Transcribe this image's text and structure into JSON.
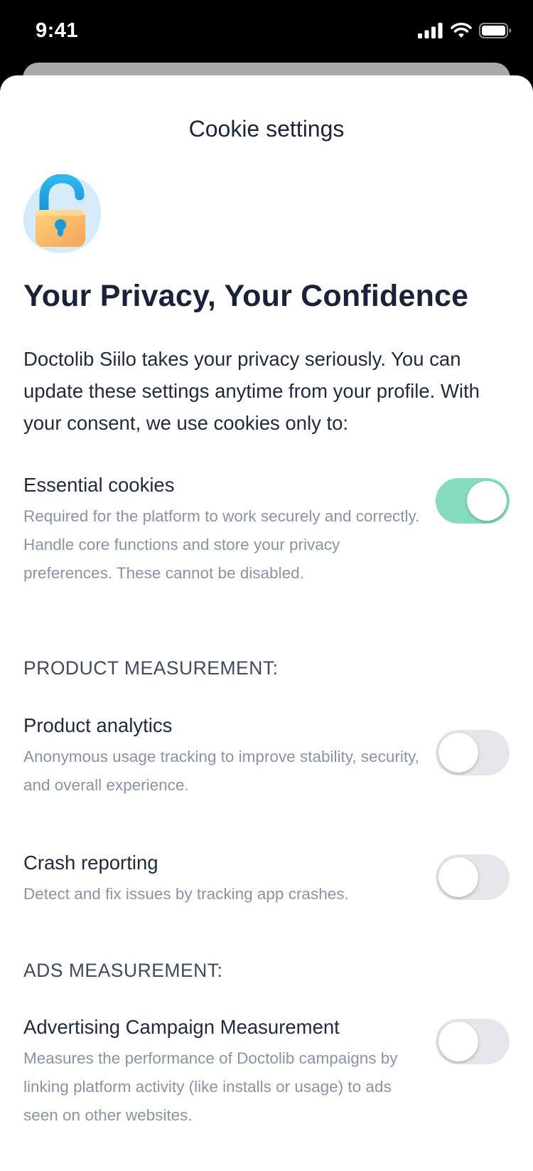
{
  "status_bar": {
    "time": "9:41"
  },
  "sheet": {
    "title": "Cookie settings",
    "headline": "Your Privacy, Your Confidence",
    "intro": "Doctolib Siilo takes your privacy seriously. You can update these settings anytime from your profile. With your consent, we use cookies only to:"
  },
  "essential": {
    "title": "Essential cookies",
    "description": "Required for the platform to work securely and correctly. Handle core functions and store your privacy preferences. These cannot be disabled.",
    "enabled": true
  },
  "product_measurement": {
    "heading": "PRODUCT MEASUREMENT:",
    "items": [
      {
        "title": "Product analytics",
        "description": "Anonymous usage tracking to improve stability, security, and overall experience.",
        "enabled": false
      },
      {
        "title": "Crash reporting",
        "description": "Detect and fix issues by tracking app crashes.",
        "enabled": false
      }
    ]
  },
  "ads_measurement": {
    "heading": "ADS MEASUREMENT:",
    "items": [
      {
        "title": "Advertising Campaign Measurement",
        "description": "Measures the performance of Doctolib campaigns by linking platform activity (like installs or usage) to ads seen on other websites.",
        "enabled": false
      }
    ]
  },
  "colors": {
    "toggle_on": "#85dcbe",
    "toggle_off": "#e5e6ea",
    "text_primary": "#1f2a3d",
    "text_secondary": "#8993a6"
  },
  "icons": {
    "lock": "unlocked-padlock-icon",
    "signal": "cellular-signal-icon",
    "wifi": "wifi-icon",
    "battery": "battery-icon"
  }
}
